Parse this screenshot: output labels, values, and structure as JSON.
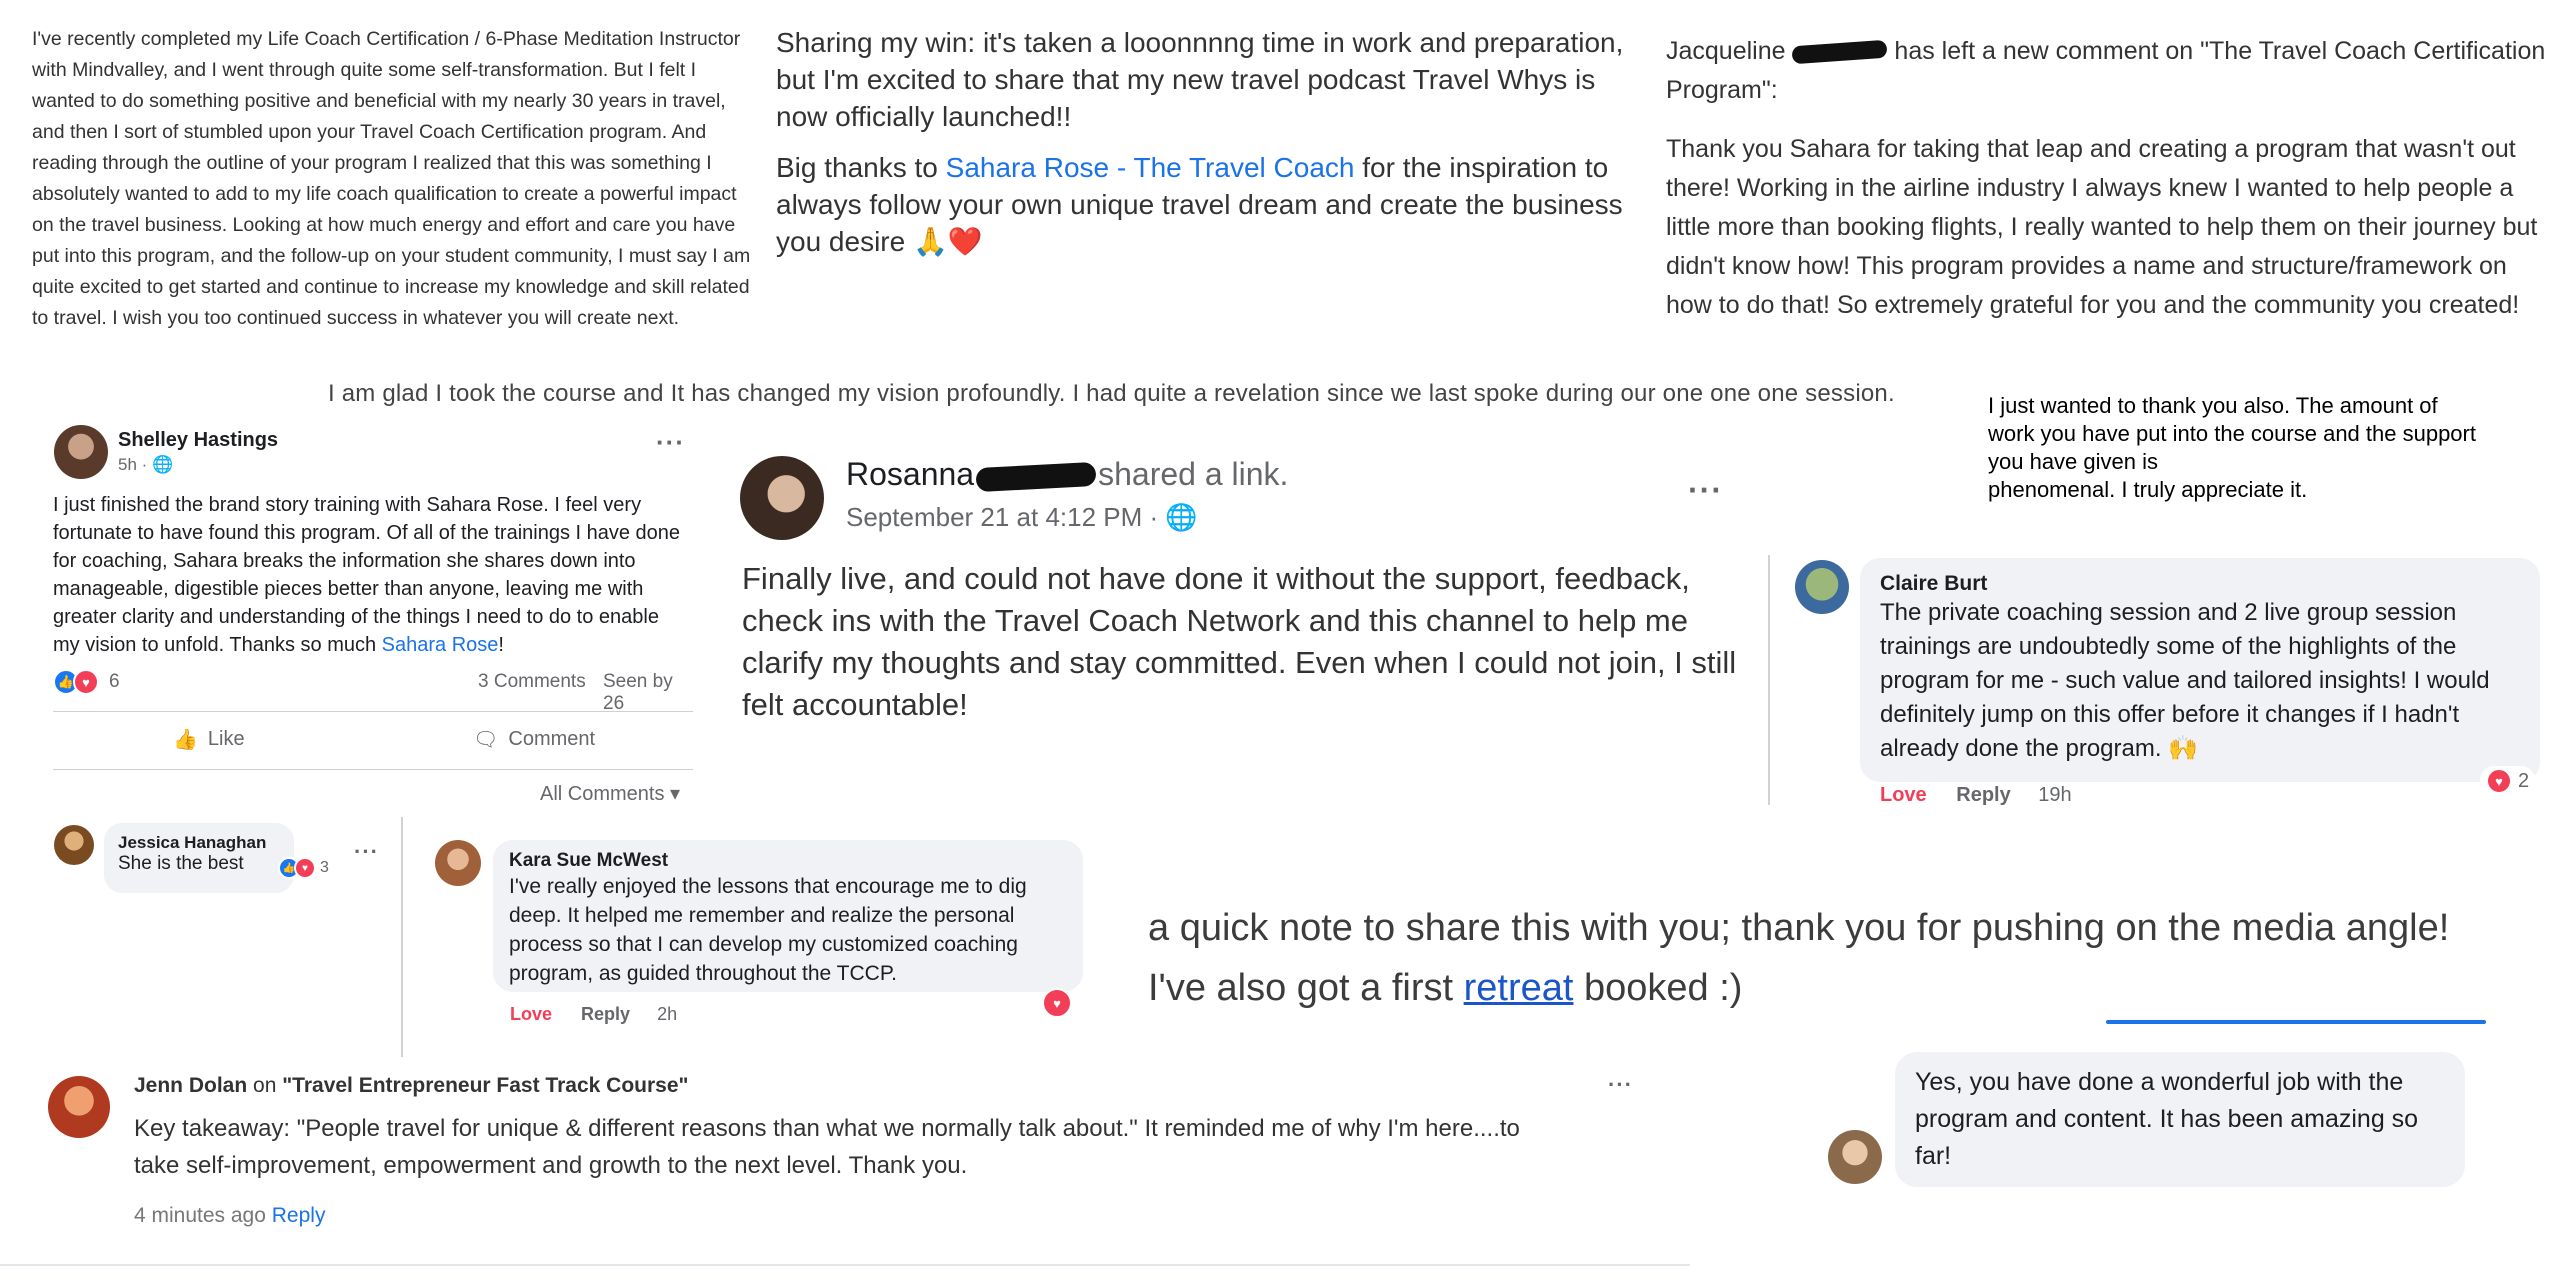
{
  "testimonial_1": {
    "text": "I've recently completed my Life Coach Certification / 6-Phase Meditation Instructor with Mindvalley, and I went through quite some self-transformation. But I felt I wanted to do something positive and beneficial with my nearly 30 years in travel, and then I sort of stumbled upon your Travel Coach Certification program. And reading through the outline of your program I realized that this was something I absolutely wanted to add to my life coach qualification to create a powerful impact on the travel business. Looking at how much energy and effort and care you have put into this program, and the follow-up on your student community, I must say I am quite excited to get started and continue to increase my knowledge and skill related to travel. I wish you too continued success in whatever you will create next."
  },
  "testimonial_2": {
    "para1": "Sharing my win: it's taken a looonnnng time in work and preparation, but I'm excited to share that my new travel podcast Travel Whys is now officially launched!!",
    "para2_before": "Big thanks to ",
    "para2_link": "Sahara Rose - The Travel Coach",
    "para2_after": " for the inspiration to always follow your own unique travel dream and create the business you desire 🙏❤️"
  },
  "testimonial_3": {
    "name_start": "Jacqueline",
    "header_rest": " has left a new comment on \"The Travel Coach Certification Program\":",
    "body": "Thank you Sahara for taking that leap and creating a program that wasn't out there! Working in the airline industry I always knew I wanted to help people a little more than booking flights, I really wanted to help them on their journey but didn't know how! This program provides a name and structure/framework on how to do that! So extremely grateful for you and the community you created!"
  },
  "banner": {
    "text": "I am glad I took the course and It has changed my vision profoundly. I had quite a revelation since we last spoke during our one one one session."
  },
  "testimonial_4": {
    "line1": "I just wanted to thank you also. The amount of",
    "line2": "work you have put into the course and the support",
    "line3": "you have given  is",
    "line4": "phenomenal. I truly appreciate it."
  },
  "shelley_post": {
    "name": "Shelley Hastings",
    "meta": "5h · 🌐",
    "body": "I just finished the brand story training with Sahara Rose. I feel very fortunate to have found this program. Of all of the trainings I have done for coaching, Sahara breaks the information she shares down into manageable, digestible pieces better than anyone, leaving me with greater clarity and understanding of the things I need to do to enable my vision to unfold. Thanks so much ",
    "body_link": "Sahara Rose",
    "body_end": "!",
    "reaction_count": "6",
    "comments": "3 Comments",
    "seen": "Seen by 26",
    "like_label": "Like",
    "comment_label": "Comment",
    "all_comments": "All Comments",
    "comment_name": "Jessica Hanaghan",
    "comment_text": "She is the best",
    "comment_reacts": "3"
  },
  "rosanna_post": {
    "name": "Rosanna",
    "shared": "shared a link.",
    "date": "September 21 at 4:12 PM · 🌐",
    "body": "Finally live, and could not have done it without the support, feedback, check ins with the Travel Coach Network and this channel to help me clarify my thoughts and stay committed.  Even when I could not join, I still felt accountable!"
  },
  "claire_comment": {
    "name": "Claire Burt",
    "body": "The private coaching session and 2 live group session trainings are undoubtedly some of the highlights of the program for me - such value and tailored insights! I would definitely jump on this offer before it changes if I hadn't already done the program. 🙌",
    "love": "Love",
    "reply": "Reply",
    "time": "19h",
    "reacts": "2"
  },
  "kara_comment": {
    "name": "Kara Sue McWest",
    "body": "I've really enjoyed the lessons that encourage me to dig deep. It helped me remember and realize the personal process so that I can develop my customized coaching program, as guided throughout the TCCP.",
    "love": "Love",
    "reply": "Reply",
    "time": "2h"
  },
  "retreat_note": {
    "line1": "a quick note to share this with you; thank you for pushing on the media angle!",
    "line2_before": "I've also got a first ",
    "line2_link": "retreat",
    "line2_after": " booked :)"
  },
  "jenn_comment": {
    "name": "Jenn Dolan",
    "on": " on ",
    "course": "\"Travel Entrepreneur Fast Track Course\"",
    "body": "Key takeaway: \"People travel for unique & different reasons than what we normally talk about.\" It reminded me of why I'm here....to take self-improvement, empowerment and growth to the next level. Thank you.",
    "time": "4 minutes ago",
    "reply": "Reply",
    "more": "···"
  },
  "yes_comment": {
    "body": "Yes, you have done a wonderful job with the program and content. It has been amazing so far!"
  },
  "colors": {
    "link": "#1a73e8",
    "love": "#f33e58",
    "like": "#1877f2",
    "bubble": "#f0f2f5"
  }
}
